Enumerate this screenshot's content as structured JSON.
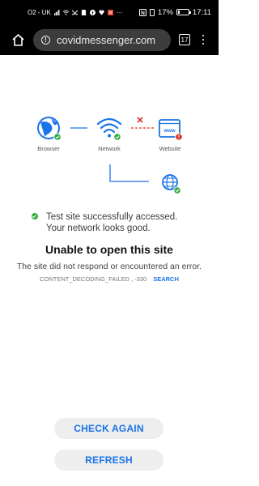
{
  "status_bar": {
    "carrier": "O2 - UK",
    "battery": "17%",
    "battery_level": 0.17,
    "time": "17:11"
  },
  "toolbar": {
    "url": "covidmessenger.com",
    "tab_count": "17"
  },
  "diagram": {
    "browser_label": "Browser",
    "network_label": "Network",
    "website_label": "Website",
    "website_icon_text": "www"
  },
  "status_message": "Test site successfully accessed. Your network looks good.",
  "error": {
    "title": "Unable to open this site",
    "description": "The site did not respond or encountered an error.",
    "code": "CONTENT_DECODING_FAILED , -330",
    "search_label": "SEARCH"
  },
  "actions": {
    "check_again_label": "CHECK AGAIN",
    "refresh_label": "REFRESH"
  },
  "colors": {
    "accent": "#1a73e8",
    "success": "#2faa3f",
    "error": "#d93025"
  }
}
